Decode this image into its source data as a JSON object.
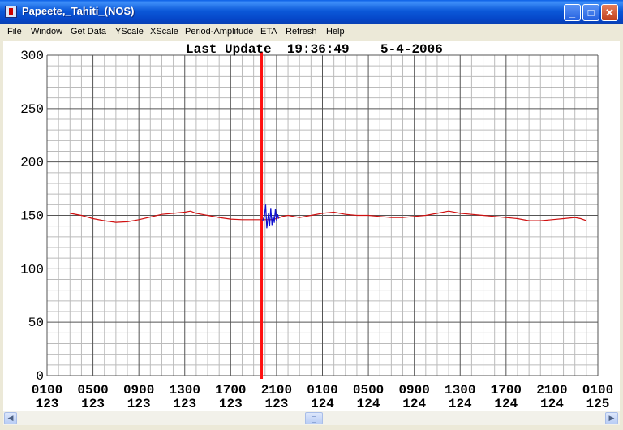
{
  "window": {
    "title": "Papeete,_Tahiti_(NOS)",
    "minimize_glyph": "_",
    "maximize_glyph": "□",
    "close_glyph": "✕"
  },
  "menu": [
    "File",
    "Window",
    "Get Data",
    "YScale",
    "XScale",
    "Period-Amplitude",
    "ETA",
    "Refresh",
    "Help"
  ],
  "scrollbar": {
    "left_glyph": "◀",
    "right_glyph": "▶"
  },
  "colors": {
    "observed_line": "#d01010",
    "marker": "#ff1010",
    "recent_line": "#1010d0",
    "grid_major": "#555555",
    "grid_minor": "#bbbbbb"
  },
  "chart_data": {
    "type": "line",
    "title": "Last Update  19:36:49    5-4-2006",
    "ylim": [
      0,
      300
    ],
    "y_ticks": [
      0,
      50,
      100,
      150,
      200,
      250,
      300
    ],
    "x_ticks": [
      {
        "time": "0100",
        "day": "123"
      },
      {
        "time": "0500",
        "day": "123"
      },
      {
        "time": "0900",
        "day": "123"
      },
      {
        "time": "1300",
        "day": "123"
      },
      {
        "time": "1700",
        "day": "123"
      },
      {
        "time": "2100",
        "day": "123"
      },
      {
        "time": "0100",
        "day": "124"
      },
      {
        "time": "0500",
        "day": "124"
      },
      {
        "time": "0900",
        "day": "124"
      },
      {
        "time": "1300",
        "day": "124"
      },
      {
        "time": "1700",
        "day": "124"
      },
      {
        "time": "2100",
        "day": "124"
      },
      {
        "time": "0100",
        "day": "125"
      }
    ],
    "x_range_hours": [
      0,
      48
    ],
    "marker_hour": 18.7,
    "series": [
      {
        "color": "#d01010",
        "points": [
          [
            2.0,
            152
          ],
          [
            3.0,
            150
          ],
          [
            4.0,
            147
          ],
          [
            5.0,
            145
          ],
          [
            6.0,
            143.5
          ],
          [
            7.0,
            144
          ],
          [
            8.0,
            146
          ],
          [
            9.0,
            148.5
          ],
          [
            10.0,
            151
          ],
          [
            11.0,
            152
          ],
          [
            12.0,
            153
          ],
          [
            12.5,
            154
          ],
          [
            13.0,
            152
          ],
          [
            14.0,
            150
          ],
          [
            15.0,
            148
          ],
          [
            16.0,
            146.5
          ],
          [
            17.0,
            146
          ],
          [
            18.0,
            146
          ],
          [
            18.7,
            146
          ],
          [
            19.5,
            146
          ],
          [
            20.0,
            147
          ],
          [
            20.5,
            149
          ],
          [
            21.0,
            150
          ],
          [
            21.5,
            149
          ],
          [
            22.0,
            148
          ],
          [
            23.0,
            150
          ],
          [
            24.0,
            152
          ],
          [
            25.0,
            153
          ],
          [
            26.0,
            151
          ],
          [
            27.0,
            150
          ],
          [
            28.0,
            150
          ],
          [
            29.0,
            149
          ],
          [
            30.0,
            148
          ],
          [
            31.0,
            148
          ],
          [
            32.0,
            149
          ],
          [
            33.0,
            150
          ],
          [
            34.0,
            152
          ],
          [
            35.0,
            154
          ],
          [
            36.0,
            152
          ],
          [
            37.0,
            151
          ],
          [
            38.0,
            150
          ],
          [
            39.0,
            149
          ],
          [
            40.0,
            148
          ],
          [
            41.0,
            147
          ],
          [
            42.0,
            145
          ],
          [
            43.0,
            145
          ],
          [
            44.0,
            146
          ],
          [
            45.0,
            147
          ],
          [
            46.0,
            148
          ],
          [
            46.5,
            147
          ],
          [
            47.0,
            145
          ]
        ]
      },
      {
        "color": "#1010d0",
        "points": [
          [
            18.8,
            145
          ],
          [
            18.95,
            150
          ],
          [
            19.05,
            160
          ],
          [
            19.15,
            138
          ],
          [
            19.3,
            152
          ],
          [
            19.4,
            140
          ],
          [
            19.5,
            157
          ],
          [
            19.6,
            141
          ],
          [
            19.7,
            150
          ],
          [
            19.8,
            143
          ],
          [
            19.9,
            156
          ],
          [
            20.0,
            145
          ],
          [
            20.1,
            151
          ],
          [
            20.2,
            147
          ]
        ]
      }
    ]
  }
}
